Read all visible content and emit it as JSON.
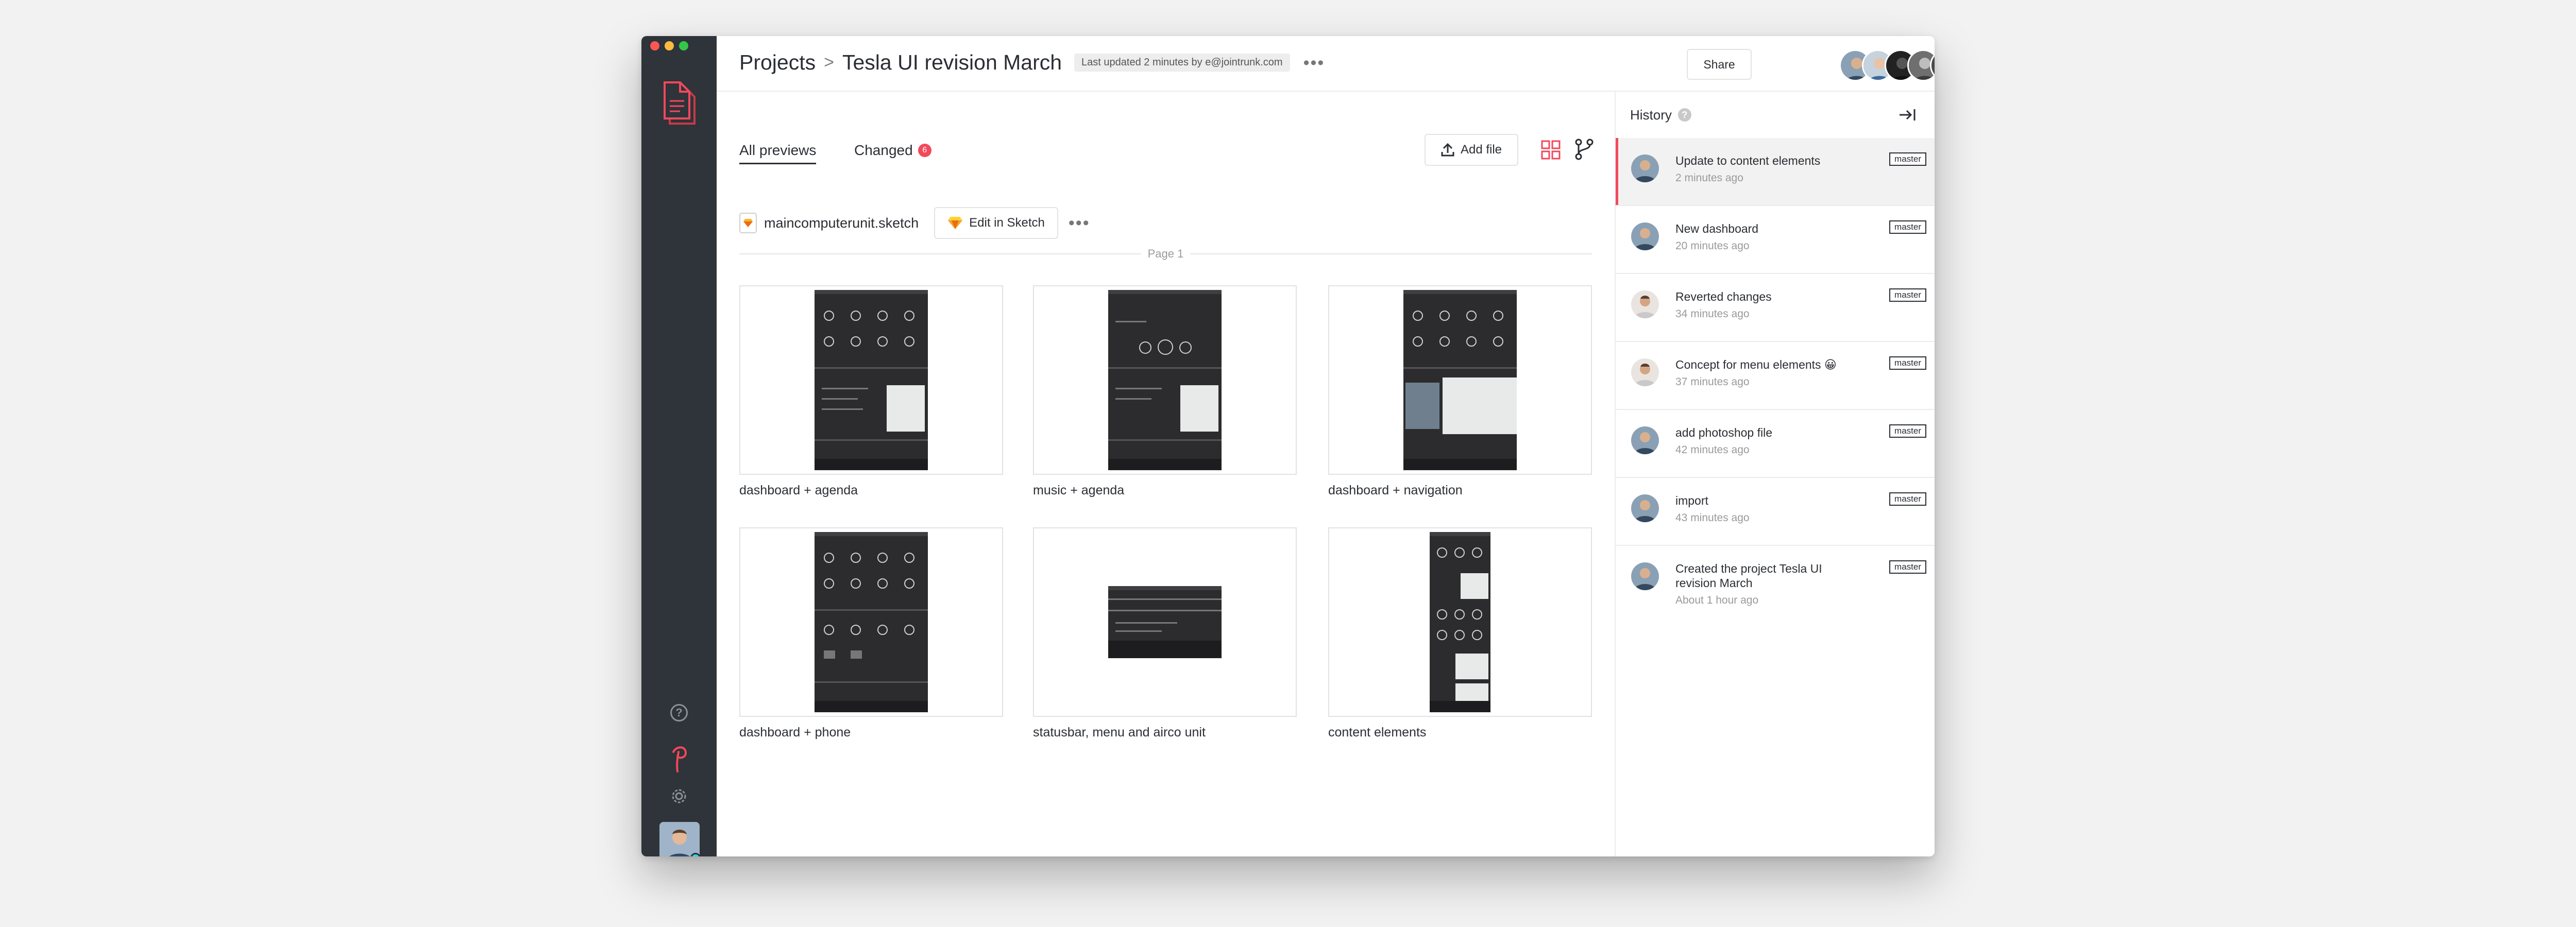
{
  "header": {
    "breadcrumb_root": "Projects",
    "breadcrumb_separator": ">",
    "project_title": "Tesla UI revision March",
    "last_updated": "Last updated 2 minutes by e@jointrunk.com",
    "more": "•••",
    "share_label": "Share",
    "add_member": "+"
  },
  "tabs": {
    "all": "All previews",
    "changed": "Changed",
    "changed_count": "6"
  },
  "toolbar": {
    "add_file_label": "Add file"
  },
  "file": {
    "name": "maincomputerunit.sketch",
    "edit_label": "Edit in Sketch",
    "more": "•••"
  },
  "page_label": "Page 1",
  "previews": [
    {
      "caption": "dashboard + agenda"
    },
    {
      "caption": "music + agenda"
    },
    {
      "caption": "dashboard + navigation"
    },
    {
      "caption": "dashboard + phone"
    },
    {
      "caption": "statusbar, menu and airco unit"
    },
    {
      "caption": "content elements"
    }
  ],
  "history": {
    "title": "History",
    "help": "?",
    "items": [
      {
        "message": "Update to content elements",
        "time": "2 minutes ago",
        "branch": "master"
      },
      {
        "message": "New dashboard",
        "time": "20 minutes ago",
        "branch": "master"
      },
      {
        "message": "Reverted changes",
        "time": "34 minutes ago",
        "branch": "master"
      },
      {
        "message": "Concept for menu elements 😀",
        "time": "37 minutes ago",
        "branch": "master"
      },
      {
        "message": "add photoshop file",
        "time": "42 minutes ago",
        "branch": "master"
      },
      {
        "message": "import",
        "time": "43 minutes ago",
        "branch": "master"
      },
      {
        "message": "Created the project Tesla UI revision March",
        "time": "About 1 hour ago",
        "branch": "master"
      }
    ]
  },
  "sidebar": {
    "help": "?"
  },
  "colors": {
    "sidebar": "#2f333a",
    "accent": "#f2495b",
    "online": "#28d5e8",
    "sketch": "#f7b52c"
  }
}
